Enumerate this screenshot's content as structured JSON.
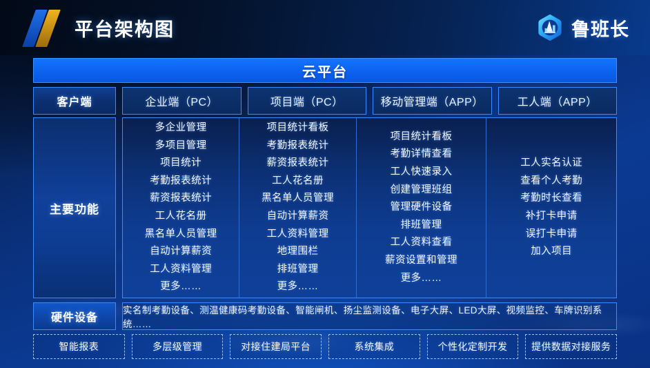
{
  "header": {
    "title": "平台架构图",
    "logo_mark_icon": "double-slash-logo-icon",
    "brand_icon": "hexagon-building-logo-icon",
    "brand_name": "鲁班长"
  },
  "cloud_banner": {
    "label": "云平台"
  },
  "client_row": {
    "label": "客户端",
    "items": [
      {
        "label": "企业端（PC）"
      },
      {
        "label": "项目端（PC）"
      },
      {
        "label": "移动管理端（APP）"
      },
      {
        "label": "工人端（APP）"
      }
    ]
  },
  "functions": {
    "label": "主要功能",
    "columns": [
      {
        "owner": "企业端（PC）",
        "items": [
          "多企业管理",
          "多项目管理",
          "项目统计",
          "考勤报表统计",
          "薪资报表统计",
          "工人花名册",
          "黑名单人员管理",
          "自动计算薪资",
          "工人资料管理",
          "更多……"
        ]
      },
      {
        "owner": "项目端（PC）",
        "items": [
          "项目统计看板",
          "考勤报表统计",
          "薪资报表统计",
          "工人花名册",
          "黑名单人员管理",
          "自动计算薪资",
          "工人资料管理",
          "地理围栏",
          "排班管理",
          "更多……"
        ]
      },
      {
        "owner": "移动管理端（APP）",
        "items": [
          "项目统计看板",
          "考勤详情查看",
          "工人快速录入",
          "创建管理班组",
          "管理硬件设备",
          "排班管理",
          "工人资料查看",
          "薪资设置和管理",
          "更多……"
        ]
      },
      {
        "owner": "工人端（APP）",
        "items": [
          "工人实名认证",
          "查看个人考勤",
          "考勤时长查看",
          "补打卡申请",
          "误打卡申请",
          "加入项目"
        ]
      }
    ]
  },
  "hardware": {
    "label": "硬件设备",
    "content": "实名制考勤设备、测温健康码考勤设备、智能闸机、扬尘监测设备、电子大屏、LED大屏、视频监控、车牌识别系统……"
  },
  "services": {
    "tags": [
      "智能报表",
      "多层级管理",
      "对接住建局平台",
      "系统集成",
      "个性化定制开发",
      "提供数据对接服务"
    ]
  },
  "colors": {
    "accent_blue": "#0c62ef",
    "border_blue": "#3d8cff",
    "gold": "#f0b422",
    "background_deep": "#0b3b92",
    "header_dark": "#020a18"
  }
}
